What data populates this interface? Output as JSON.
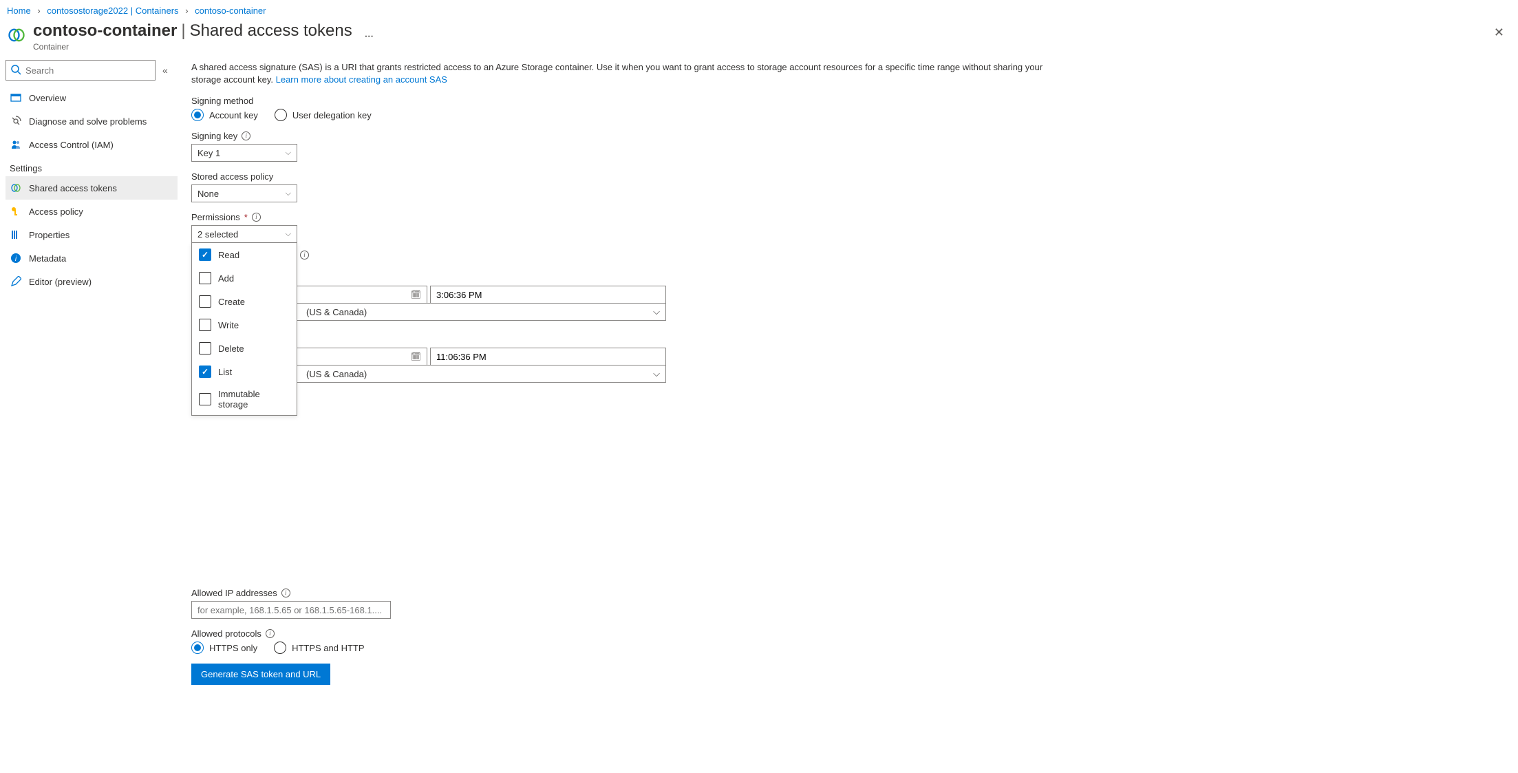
{
  "breadcrumb": {
    "home": "Home",
    "storage": "contosostorage2022 | Containers",
    "container": "contoso-container"
  },
  "header": {
    "title_main": "contoso-container",
    "title_sub": "Shared access tokens",
    "subtitle": "Container"
  },
  "sidebar": {
    "search_placeholder": "Search",
    "items_top": [
      {
        "label": "Overview"
      },
      {
        "label": "Diagnose and solve problems"
      },
      {
        "label": "Access Control (IAM)"
      }
    ],
    "section": "Settings",
    "items_settings": [
      {
        "label": "Shared access tokens"
      },
      {
        "label": "Access policy"
      },
      {
        "label": "Properties"
      },
      {
        "label": "Metadata"
      },
      {
        "label": "Editor (preview)"
      }
    ]
  },
  "intro": {
    "text": "A shared access signature (SAS) is a URI that grants restricted access to an Azure Storage container. Use it when you want to grant access to storage account resources for a specific time range without sharing your storage account key. ",
    "link": "Learn more about creating an account SAS"
  },
  "signing_method": {
    "label": "Signing method",
    "opt1": "Account key",
    "opt2": "User delegation key"
  },
  "signing_key": {
    "label": "Signing key",
    "value": "Key 1"
  },
  "stored_policy": {
    "label": "Stored access policy",
    "value": "None"
  },
  "permissions": {
    "label": "Permissions",
    "value": "2 selected",
    "options": [
      {
        "label": "Read",
        "checked": true
      },
      {
        "label": "Add",
        "checked": false
      },
      {
        "label": "Create",
        "checked": false
      },
      {
        "label": "Write",
        "checked": false
      },
      {
        "label": "Delete",
        "checked": false
      },
      {
        "label": "List",
        "checked": true
      },
      {
        "label": "Immutable storage",
        "checked": false
      }
    ]
  },
  "start_time": {
    "time": "3:06:36 PM",
    "tz": "(US & Canada)"
  },
  "end_time": {
    "time": "11:06:36 PM",
    "tz": "(US & Canada)"
  },
  "allowed_ip": {
    "label": "Allowed IP addresses",
    "placeholder": "for example, 168.1.5.65 or 168.1.5.65-168.1...."
  },
  "allowed_protocols": {
    "label": "Allowed protocols",
    "opt1": "HTTPS only",
    "opt2": "HTTPS and HTTP"
  },
  "generate_button": "Generate SAS token and URL"
}
